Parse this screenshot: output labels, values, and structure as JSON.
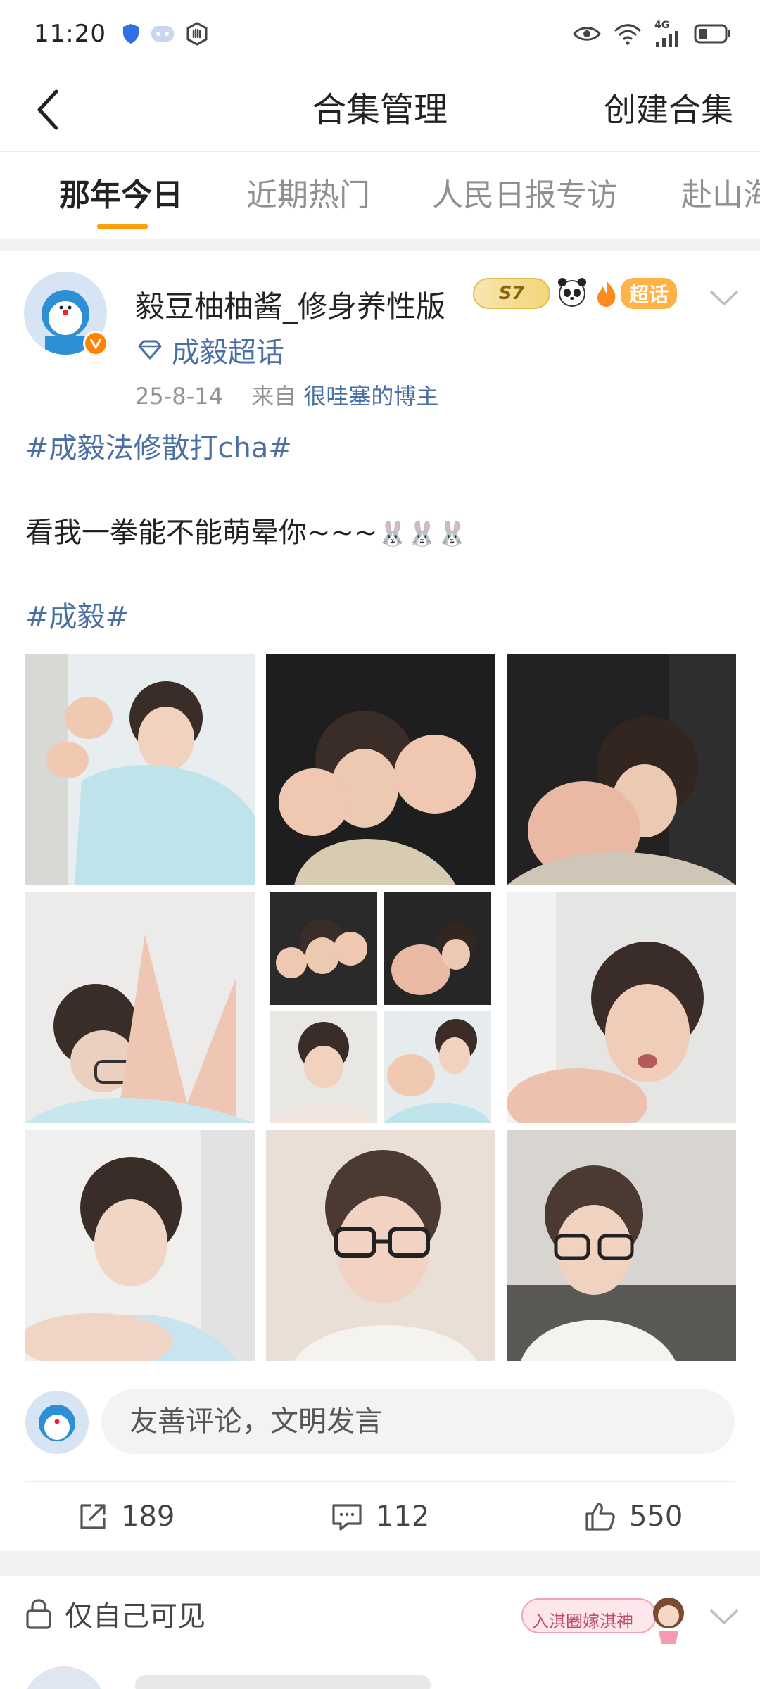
{
  "status_bar": {
    "time": "11:20",
    "network": "4G",
    "colors": {
      "shield": "#2f6fe4",
      "text": "#222222"
    }
  },
  "nav": {
    "title": "合集管理",
    "create_label": "创建合集"
  },
  "tabs": [
    {
      "label": "那年今日",
      "active": true
    },
    {
      "label": "近期热门",
      "active": false
    },
    {
      "label": "人民日报专访",
      "active": false
    },
    {
      "label": "赴山海",
      "active": false
    }
  ],
  "post": {
    "username": "毅豆柚柚酱_修身养性版",
    "level_badge": "S7",
    "super_badge": "超话",
    "supertopic": "成毅超话",
    "date": "25-8-14",
    "source_prefix": "来自",
    "source": "很哇塞的博主",
    "hashtag_top": "#成毅法修散打cha#",
    "body": "看我一拳能不能萌晕你~~~",
    "emoji": "🐰🐰🐰",
    "hashtag_bottom": "#成毅#",
    "photo_count": 9,
    "comment_placeholder": "友善评论，文明发言",
    "stats": {
      "reposts": "189",
      "comments": "112",
      "likes": "550"
    },
    "colors": {
      "link": "#4a6fa5",
      "accent": "#ff9f0a",
      "verified": "#ff8200"
    }
  },
  "next_post": {
    "visibility": "仅自己可见",
    "badge": "入淇圈嫁淇神"
  }
}
